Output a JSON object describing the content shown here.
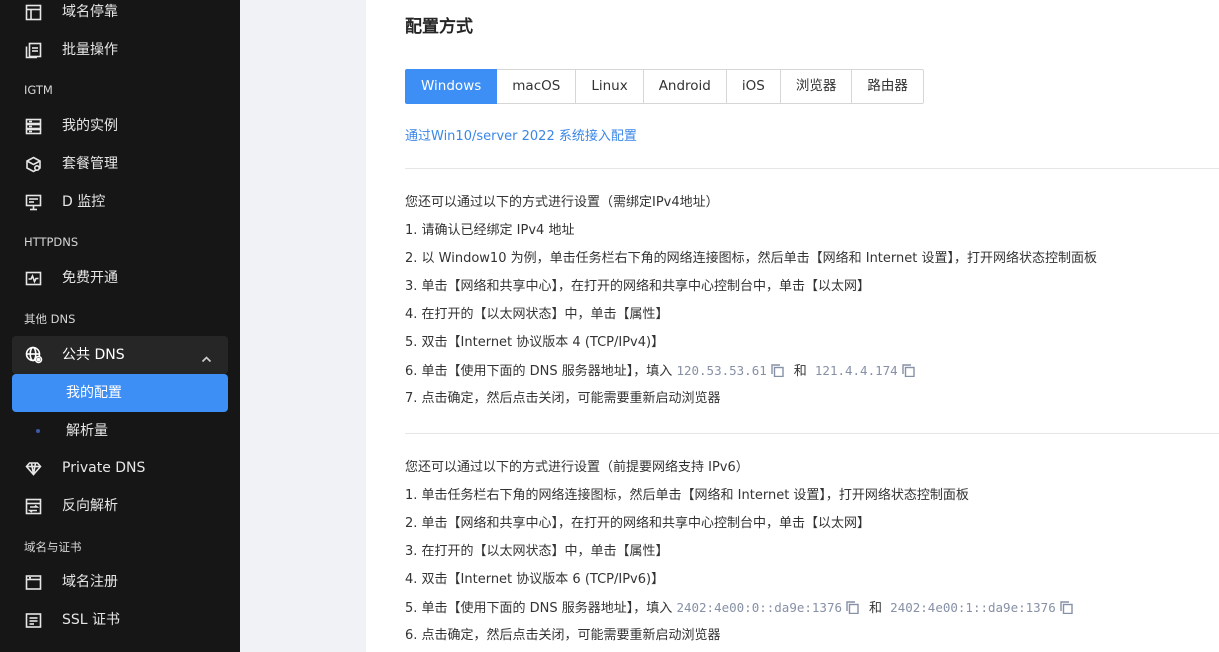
{
  "sidebar": {
    "items": [
      {
        "label": "域名停靠",
        "icon": "layout-icon"
      },
      {
        "label": "批量操作",
        "icon": "copy-stack-icon"
      },
      {
        "label": "我的实例",
        "icon": "server-icon"
      },
      {
        "label": "套餐管理",
        "icon": "package-icon"
      },
      {
        "label": "D 监控",
        "icon": "monitor-icon"
      },
      {
        "label": "免费开通",
        "icon": "activity-icon"
      }
    ],
    "sections": {
      "igtm": "IGTM",
      "httpdns": "HTTPDNS",
      "other_dns": "其他 DNS",
      "domain_cert": "域名与证书"
    },
    "group": {
      "label": "公共 DNS",
      "icon": "globe-icon",
      "expanded": true
    },
    "sub_active": {
      "label": "我的配置"
    },
    "sub_item": {
      "label": "解析量"
    },
    "items_after": [
      {
        "label": "Private DNS",
        "icon": "diamond-icon"
      },
      {
        "label": "反向解析",
        "icon": "reverse-icon"
      },
      {
        "label": "域名注册",
        "icon": "browser-window-icon"
      },
      {
        "label": "SSL 证书",
        "icon": "certificate-icon"
      }
    ]
  },
  "main": {
    "title": "配置方式",
    "tabs": [
      {
        "label": "Windows",
        "active": true
      },
      {
        "label": "macOS",
        "active": false
      },
      {
        "label": "Linux",
        "active": false
      },
      {
        "label": "Android",
        "active": false
      },
      {
        "label": "iOS",
        "active": false
      },
      {
        "label": "浏览器",
        "active": false
      },
      {
        "label": "路由器",
        "active": false
      }
    ],
    "link_text": "通过Win10/server 2022 系统接入配置",
    "ipv4": {
      "intro": "您还可以通过以下的方式进行设置（需绑定IPv4地址）",
      "steps": [
        "1. 请确认已经绑定 IPv4 地址",
        "2. 以 Window10 为例，单击任务栏右下角的网络连接图标，然后单击【网络和 Internet 设置】，打开网络状态控制面板",
        "3. 单击【网络和共享中心】，在打开的网络和共享中心控制台中，单击【以太网】",
        "4. 在打开的【以太网状态】中，单击【属性】",
        "5. 双击【Internet 协议版本 4 (TCP/IPv4)】"
      ],
      "dns_prefix": "6. 单击【使用下面的 DNS 服务器地址】，填入",
      "dns1": "120.53.53.61",
      "and": "和",
      "dns2": "121.4.4.174",
      "last": "7. 点击确定，然后点击关闭，可能需要重新启动浏览器"
    },
    "ipv6": {
      "intro": "您还可以通过以下的方式进行设置（前提要网络支持 IPv6）",
      "steps": [
        "1. 单击任务栏右下角的网络连接图标，然后单击【网络和 Internet 设置】，打开网络状态控制面板",
        "2. 单击【网络和共享中心】，在打开的网络和共享中心控制台中，单击【以太网】",
        "3. 在打开的【以太网状态】中，单击【属性】",
        "4. 双击【Internet 协议版本 6 (TCP/IPv6)】"
      ],
      "dns_prefix": "5. 单击【使用下面的 DNS 服务器地址】，填入",
      "dns1": "2402:4e00:0::da9e:1376",
      "and": "和",
      "dns2": "2402:4e00:1::da9e:1376",
      "last": "6. 点击确定，然后点击关闭，可能需要重新启动浏览器"
    }
  },
  "colors": {
    "accent": "#3d8ef5",
    "sidebar_bg": "#161616",
    "link": "#3a87e8"
  }
}
